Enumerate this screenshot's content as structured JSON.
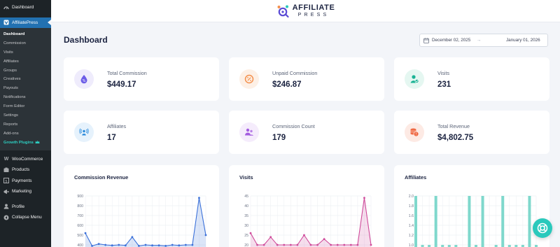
{
  "sidebar": {
    "dashboard": "Dashboard",
    "plugin": "AffiliatePress",
    "submenu": [
      "Dashboard",
      "Commission",
      "Visits",
      "Affiliates",
      "Groups",
      "Creatives",
      "Payouts",
      "Notifications",
      "Form Editor",
      "Settings",
      "Reports",
      "Add-ons"
    ],
    "growth": "Growth Plugins",
    "woocommerce": "WooCommerce",
    "products": "Products",
    "payments": "Payments",
    "marketing": "Marketing",
    "profile": "Profile",
    "collapse": "Collapse Menu"
  },
  "brand": {
    "line1": "AFFILIATE",
    "line2": "PRESS"
  },
  "page": {
    "title": "Dashboard"
  },
  "date_range": {
    "start": "December 02, 2025",
    "arrow": "→",
    "end": "January 01, 2026"
  },
  "stats": [
    {
      "label": "Total Commission",
      "value": "$449.17",
      "icon": "percent-drop-icon",
      "color": "#6c5ce7"
    },
    {
      "label": "Unpaid Commission",
      "value": "$246.87",
      "icon": "percent-badge-icon",
      "color": "#f4904c"
    },
    {
      "label": "Visits",
      "value": "231",
      "icon": "user-visit-icon",
      "color": "#19b394"
    },
    {
      "label": "Affiliates",
      "value": "17",
      "icon": "broadcast-user-icon",
      "color": "#2d8cdc"
    },
    {
      "label": "Commission Count",
      "value": "179",
      "icon": "users-group-icon",
      "color": "#a35ce0"
    },
    {
      "label": "Total Revenue",
      "value": "$4,802.75",
      "icon": "coins-icon",
      "color": "#ef6a45"
    }
  ],
  "charts": [
    {
      "title": "Commission Revenue",
      "chart_data": {
        "type": "line",
        "title": "Commission Revenue",
        "yticks": [
          "900",
          "800",
          "700",
          "600",
          "500",
          "400"
        ],
        "ylim": [
          400,
          900
        ],
        "values": [
          520,
          390,
          410,
          400,
          395,
          400,
          395,
          480,
          390,
          400,
          395,
          395,
          390,
          400,
          395,
          400,
          400,
          880,
          500
        ],
        "color": "#3a70d9"
      }
    },
    {
      "title": "Visits",
      "chart_data": {
        "type": "line",
        "title": "Visits",
        "yticks": [
          "45",
          "40",
          "35",
          "30",
          "25",
          "20"
        ],
        "ylim": [
          20,
          45
        ],
        "values": [
          26,
          20,
          20,
          24,
          20,
          20,
          20,
          20,
          25,
          20,
          20,
          23,
          20,
          20,
          20,
          20,
          20,
          44,
          20
        ],
        "color": "#cf4a9a"
      }
    },
    {
      "title": "Affiliates",
      "chart_data": {
        "type": "bar",
        "title": "Affiliates",
        "yticks": [
          "2.0",
          "1.8",
          "1.6",
          "1.4",
          "1.2",
          "1.0"
        ],
        "ylim": [
          1.0,
          2.0
        ],
        "values": [
          2,
          1,
          1,
          2,
          1,
          1,
          1,
          0,
          2,
          1,
          2,
          0,
          1,
          2,
          1,
          1,
          1,
          2,
          1
        ],
        "color": "#7fd8cc"
      }
    }
  ]
}
